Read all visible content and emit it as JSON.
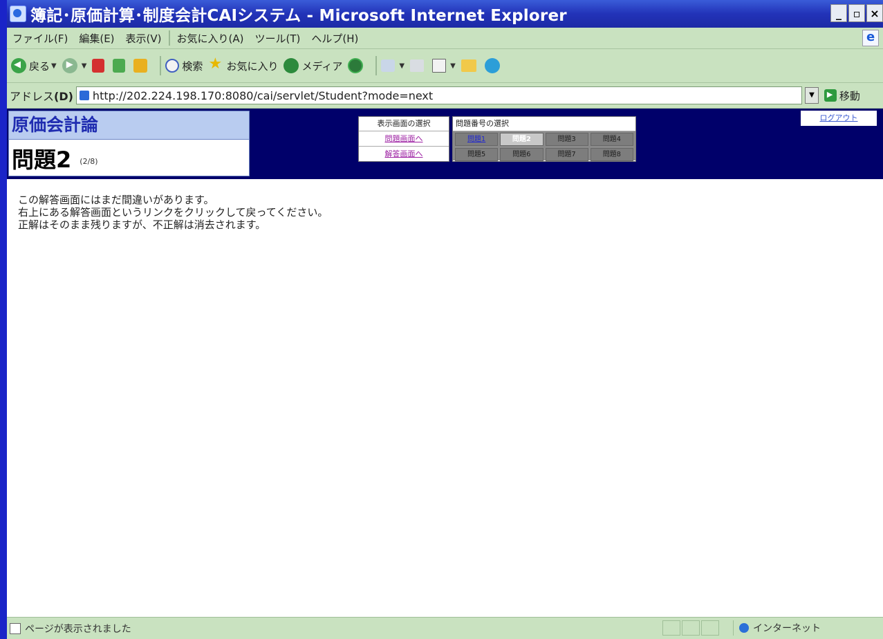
{
  "window": {
    "title": "簿記･原価計算･制度会計CAIシステム - Microsoft Internet Explorer",
    "controls": [
      "_",
      "▫",
      "×"
    ]
  },
  "menubar": {
    "items": [
      "ファイル(F)",
      "編集(E)",
      "表示(V)",
      "お気に入り(A)",
      "ツール(T)",
      "ヘルプ(H)"
    ]
  },
  "toolbar": {
    "back_label": "戻る",
    "search_label": "検索",
    "favorites_label": "お気に入り",
    "media_label": "メディア"
  },
  "address": {
    "label_prefix": "アドレス",
    "label_key": "(D)",
    "url": "http://202.224.198.170:8080/cai/servlet/Student?mode=next",
    "go_label": "移動"
  },
  "page": {
    "subject": "原価会計論",
    "question_title": "問題2",
    "question_count": "(2/8)",
    "view_select_label": "表示画面の選択",
    "view_links": [
      "問題画面へ",
      "解答画面へ"
    ],
    "question_select_label": "問題番号の選択",
    "question_buttons": [
      {
        "label": "問題1",
        "state": "linked"
      },
      {
        "label": "問題2",
        "state": "current"
      },
      {
        "label": "問題3",
        "state": "normal"
      },
      {
        "label": "問題4",
        "state": "normal"
      },
      {
        "label": "問題5",
        "state": "normal"
      },
      {
        "label": "問題6",
        "state": "normal"
      },
      {
        "label": "問題7",
        "state": "normal"
      },
      {
        "label": "問題8",
        "state": "normal"
      }
    ],
    "logout_label": "ログアウト",
    "message_lines": [
      "この解答画面にはまだ間違いがあります。",
      "右上にある解答画面というリンクをクリックして戻ってください。",
      "正解はそのまま残りますが、不正解は消去されます。"
    ]
  },
  "status": {
    "text": "ページが表示されました",
    "zone": "インターネット"
  },
  "colors": {
    "desktop": "#1a24c8",
    "nav_band": "#00006a",
    "subject_header_bg": "#b9ccf0",
    "subject_header_text": "#1f2cb0",
    "visited_link": "#9c1fa2"
  }
}
